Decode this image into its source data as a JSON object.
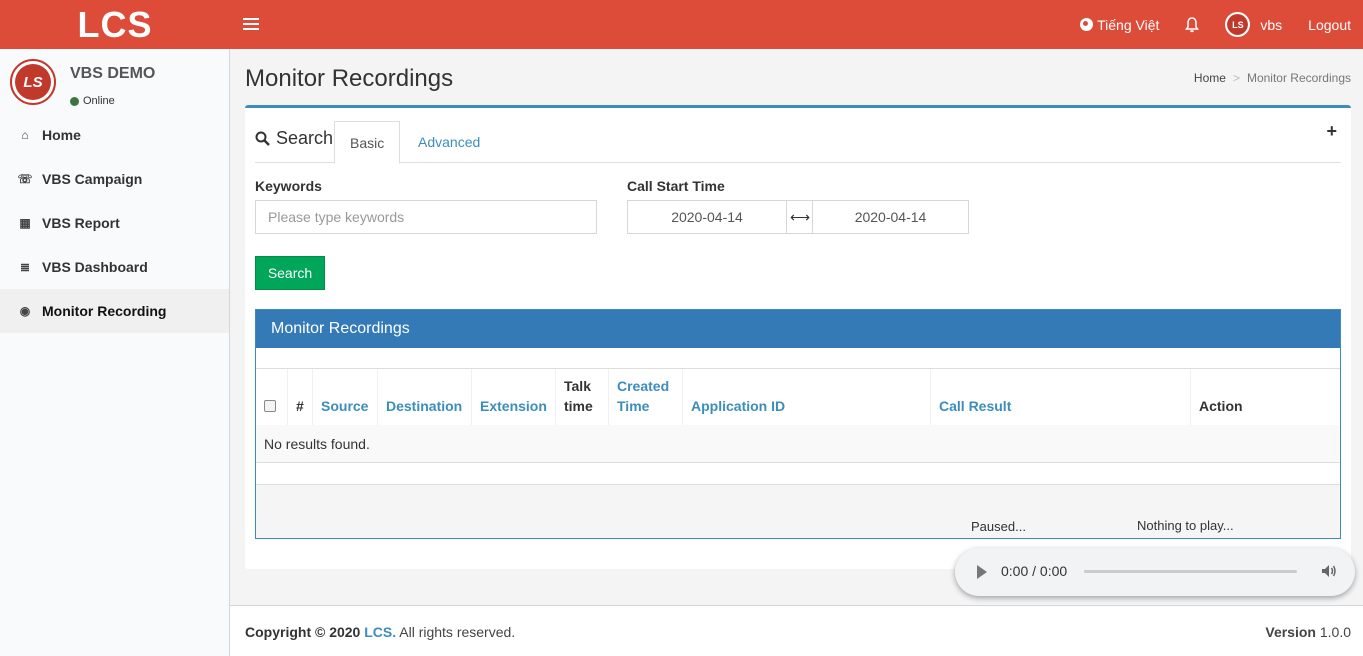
{
  "header": {
    "logo": "LCS",
    "language": "Tiếng Việt",
    "username": "vbs",
    "logout": "Logout",
    "avatar_text": "LS"
  },
  "sidebar": {
    "user_name": "VBS DEMO",
    "status": "Online",
    "items": [
      {
        "label": "Home",
        "icon": "home-icon",
        "glyph": "⌂"
      },
      {
        "label": "VBS Campaign",
        "icon": "phone-volume-icon",
        "glyph": "☏"
      },
      {
        "label": "VBS Report",
        "icon": "calculator-icon",
        "glyph": "▦"
      },
      {
        "label": "VBS Dashboard",
        "icon": "database-icon",
        "glyph": "≣"
      },
      {
        "label": "Monitor Recording",
        "icon": "play-circle-icon",
        "glyph": "◉"
      }
    ],
    "active_index": 4
  },
  "page": {
    "title": "Monitor Recordings",
    "breadcrumb": [
      "Home",
      "Monitor Recordings"
    ]
  },
  "search": {
    "heading": "Search",
    "tabs": [
      "Basic",
      "Advanced"
    ],
    "plus": "+",
    "keywords_label": "Keywords",
    "keywords_placeholder": "Please type keywords",
    "keywords_value": "",
    "date_label": "Call Start Time",
    "date_from": "2020-04-14",
    "date_to": "2020-04-14",
    "date_sep": "⟷",
    "button": "Search"
  },
  "table": {
    "title": "Monitor Recordings",
    "columns": [
      {
        "label": "",
        "link": false
      },
      {
        "label": "#",
        "link": false
      },
      {
        "label": "Source",
        "link": true
      },
      {
        "label": "Destination",
        "link": true
      },
      {
        "label": "Extension",
        "link": true
      },
      {
        "label": "Talk time",
        "link": false
      },
      {
        "label": "Created Time",
        "link": true
      },
      {
        "label": "Application ID",
        "link": true
      },
      {
        "label": "Call Result",
        "link": true
      },
      {
        "label": "Action",
        "link": false
      }
    ],
    "empty_text": "No results found.",
    "player_status_1": "Paused...",
    "player_status_2": "Nothing to play..."
  },
  "audio": {
    "time": "0:00 / 0:00"
  },
  "footer": {
    "copyright_prefix": "Copyright © 2020",
    "brand": "LCS.",
    "rights": "All rights reserved.",
    "version_label": "Version",
    "version_value": "1.0.0"
  },
  "colors": {
    "header": "#dd4b39",
    "primary": "#3c8dbc",
    "panel_head": "#337ab7",
    "success": "#00a65a"
  }
}
